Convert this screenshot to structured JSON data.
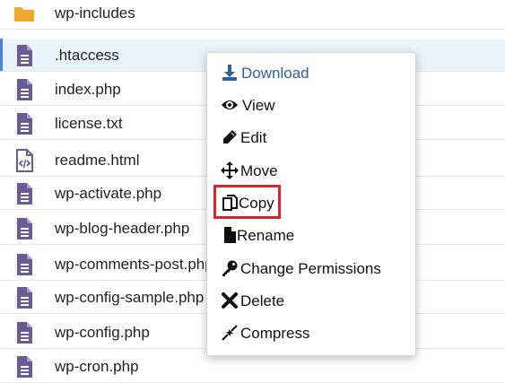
{
  "files": [
    {
      "name": "wp-includes",
      "icon": "folder-icon",
      "selected": false
    },
    {
      "name": ".htaccess",
      "icon": "file-text-icon",
      "selected": true
    },
    {
      "name": "index.php",
      "icon": "file-text-icon",
      "selected": false
    },
    {
      "name": "license.txt",
      "icon": "file-text-icon",
      "selected": false
    },
    {
      "name": "readme.html",
      "icon": "file-code-icon",
      "selected": false
    },
    {
      "name": "wp-activate.php",
      "icon": "file-text-icon",
      "selected": false
    },
    {
      "name": "wp-blog-header.php",
      "icon": "file-text-icon",
      "selected": false
    },
    {
      "name": "wp-comments-post.php",
      "icon": "file-text-icon",
      "selected": false
    },
    {
      "name": "wp-config-sample.php",
      "icon": "file-text-icon",
      "selected": false
    },
    {
      "name": "wp-config.php",
      "icon": "file-text-icon",
      "selected": false
    },
    {
      "name": "wp-cron.php",
      "icon": "file-text-icon",
      "selected": false
    }
  ],
  "context_menu": {
    "items": [
      {
        "label": "Download",
        "icon": "download-icon"
      },
      {
        "label": "View",
        "icon": "eye-icon"
      },
      {
        "label": "Edit",
        "icon": "pencil-icon"
      },
      {
        "label": "Move",
        "icon": "move-arrows-icon"
      },
      {
        "label": "Copy",
        "icon": "copy-icon",
        "highlighted": true
      },
      {
        "label": "Rename",
        "icon": "file-icon"
      },
      {
        "label": "Change Permissions",
        "icon": "key-icon"
      },
      {
        "label": "Delete",
        "icon": "x-icon"
      },
      {
        "label": "Compress",
        "icon": "compress-icon"
      }
    ]
  },
  "colors": {
    "folder": "#f0a830",
    "file_icon": "#6b5b95",
    "selected_row_bg": "#e9f3fc",
    "menu_primary": "#2f5f9f",
    "highlight_border": "#e0202a"
  }
}
